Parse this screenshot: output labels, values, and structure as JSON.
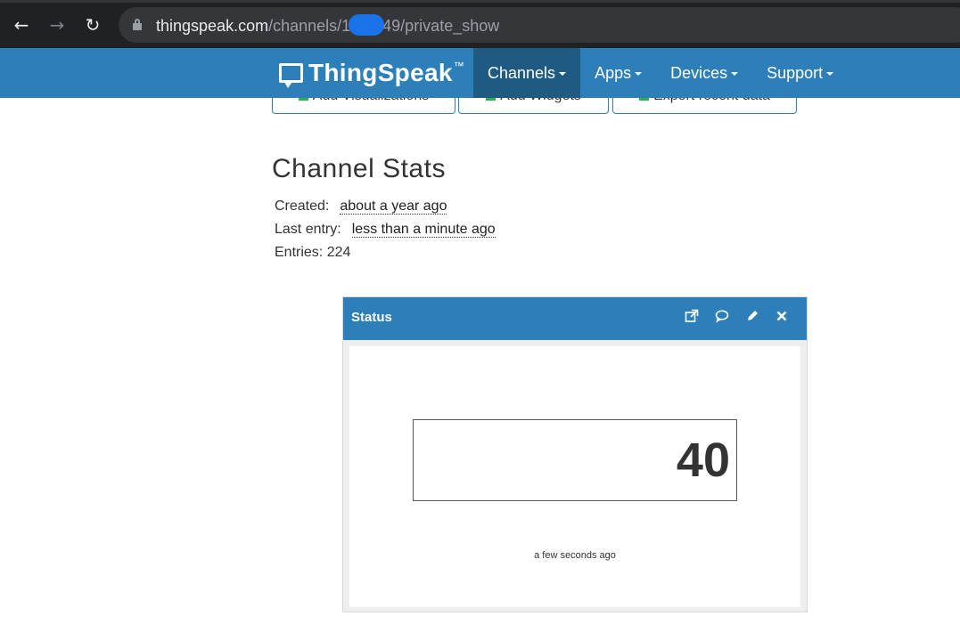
{
  "browser": {
    "url_host": "thingspeak.com",
    "url_path_prefix": "/channels/1",
    "url_path_suffix": "49/private_show"
  },
  "navbar": {
    "brand": "ThingSpeak",
    "brand_tm": "™",
    "menu": [
      {
        "label": "Channels"
      },
      {
        "label": "Apps"
      },
      {
        "label": "Devices"
      },
      {
        "label": "Support"
      }
    ]
  },
  "buttons": {
    "add_visualizations": "Add Visualizations",
    "add_widgets": "Add Widgets",
    "export_recent_data": "Export recent data"
  },
  "channel_stats": {
    "title": "Channel Stats",
    "created_label": "Created:",
    "created_value": "about a year ago",
    "last_entry_label": "Last entry:",
    "last_entry_value": "less than a minute ago",
    "entries_text": "Entries: 224"
  },
  "status_widget": {
    "title": "Status",
    "value": "40",
    "timestamp": "a few seconds ago",
    "icons": [
      "external-link-icon",
      "comment-icon",
      "pencil-icon",
      "close-icon"
    ]
  },
  "colors": {
    "nav_blue": "#2c7fb8",
    "active_blue": "#1e5a82",
    "browser_dark": "#202124"
  }
}
